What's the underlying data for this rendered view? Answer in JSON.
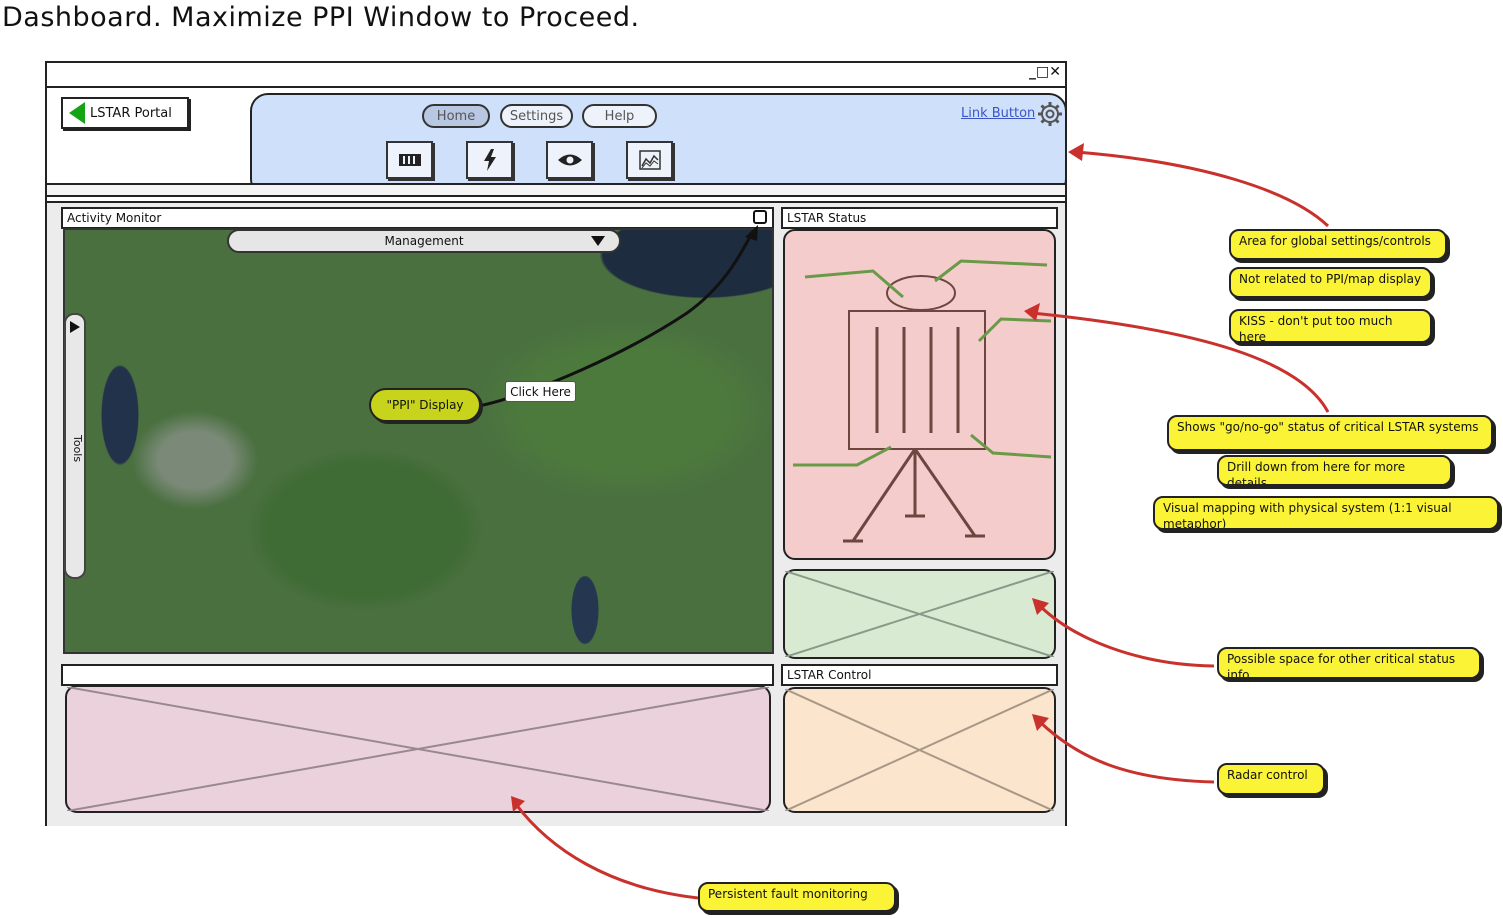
{
  "page": {
    "heading": "Dashboard.  Maximize PPI Window to Proceed."
  },
  "window": {
    "controls": "_□✕"
  },
  "toolbar": {
    "portal_label": "LSTAR Portal",
    "nav": [
      "Home",
      "Settings",
      "Help"
    ],
    "link_button": "Link Button",
    "icons": [
      "film-strip-icon",
      "lightning-icon",
      "eye-icon",
      "chart-icon"
    ]
  },
  "activity_monitor": {
    "title": "Activity Monitor",
    "dropdown_value": "Management",
    "tools_label": "Tools",
    "ppi_label": "\"PPI\" Display",
    "click_here": "Click Here"
  },
  "status_panel": {
    "title": "LSTAR Status"
  },
  "control_panel": {
    "title": "LSTAR Control"
  },
  "notes": {
    "global_1": "Area for global settings/controls",
    "global_2": "Not related to PPI/map display",
    "global_3": "KISS - don't put too much here",
    "status_1": "Shows \"go/no-go\" status of critical LSTAR systems",
    "status_2": "Drill down from here for more details",
    "status_3": "Visual mapping with physical system (1:1 visual metaphor)",
    "other_status": "Possible space for other critical status info",
    "radar": "Radar control",
    "fault": "Persistent fault monitoring"
  },
  "colors": {
    "global_bar": "#cfe0fa",
    "status_area": "#f4cccc",
    "other_status_area": "#d9ead3",
    "control_area": "#fce5cd",
    "fault_area": "#ead1dc",
    "sticky_note": "#fbf436",
    "arrow": "#c8312c",
    "portal_triangle": "#14a314"
  }
}
